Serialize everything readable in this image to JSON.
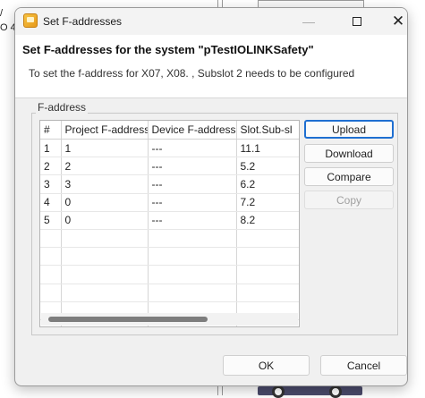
{
  "background": {
    "left_fragment_lines": [
      "/",
      "O 4"
    ]
  },
  "dialog": {
    "title": "Set F-addresses",
    "controls": {
      "minimize": "—",
      "close": "✕"
    },
    "header_title": "Set F-addresses for the system \"pTestIOLINKSafety\"",
    "header_description": "To set the f-address for X07, X08. , Subslot 2 needs to be configured",
    "group_label": "F-address",
    "table": {
      "columns": [
        "#",
        "Project F-address",
        "Device F-address",
        "Slot.Sub-sl"
      ],
      "rows": [
        [
          "1",
          "1",
          "---",
          "11.1"
        ],
        [
          "2",
          "2",
          "---",
          "5.2"
        ],
        [
          "3",
          "3",
          "---",
          "6.2"
        ],
        [
          "4",
          "0",
          "---",
          "7.2"
        ],
        [
          "5",
          "0",
          "---",
          "8.2"
        ]
      ],
      "empty_rows": 6
    },
    "side_buttons": {
      "upload": "Upload",
      "download": "Download",
      "compare": "Compare",
      "copy": "Copy"
    },
    "footer": {
      "ok": "OK",
      "cancel": "Cancel"
    }
  },
  "colors": {
    "focus_border": "#1f6fd1",
    "dialog_bg": "#f0f0f0",
    "header_bg": "#ffffff",
    "disabled_text": "#a0a0a0"
  }
}
